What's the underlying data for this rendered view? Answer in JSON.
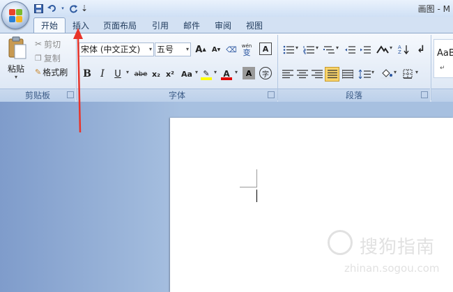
{
  "window": {
    "title": "画图 - M"
  },
  "quick_access": {
    "save_icon": "save-icon",
    "undo_icon": "undo-icon",
    "redo_icon": "redo-icon",
    "customize": "⇣"
  },
  "tabs": [
    "开始",
    "插入",
    "页面布局",
    "引用",
    "邮件",
    "审阅",
    "视图"
  ],
  "active_tab": "开始",
  "clipboard": {
    "paste": "粘贴",
    "cut": "剪切",
    "copy": "复制",
    "format_painter": "格式刷",
    "group_label": "剪贴板"
  },
  "font": {
    "font_name": "宋体 (中文正文)",
    "font_size": "五号",
    "grow": "A",
    "shrink": "A",
    "phonetic": "wén",
    "wen": "变",
    "char_border": "A",
    "bold": "B",
    "italic": "I",
    "underline": "U",
    "strike": "abe",
    "sub": "x₂",
    "sup": "x²",
    "change_case": "Aa",
    "highlight": "✎",
    "font_color": "A",
    "char_shading": "A",
    "enclose": "字",
    "group_label": "字体"
  },
  "paragraph": {
    "group_label": "段落"
  },
  "styles": {
    "sample": "AaBl",
    "mark": "↵"
  },
  "watermark": {
    "text": "搜狗指南",
    "url": "zhinan.sogou.com"
  },
  "colors": {
    "highlight": "#ffff00",
    "font_color": "#e00000",
    "arrow": "#e8342a"
  }
}
